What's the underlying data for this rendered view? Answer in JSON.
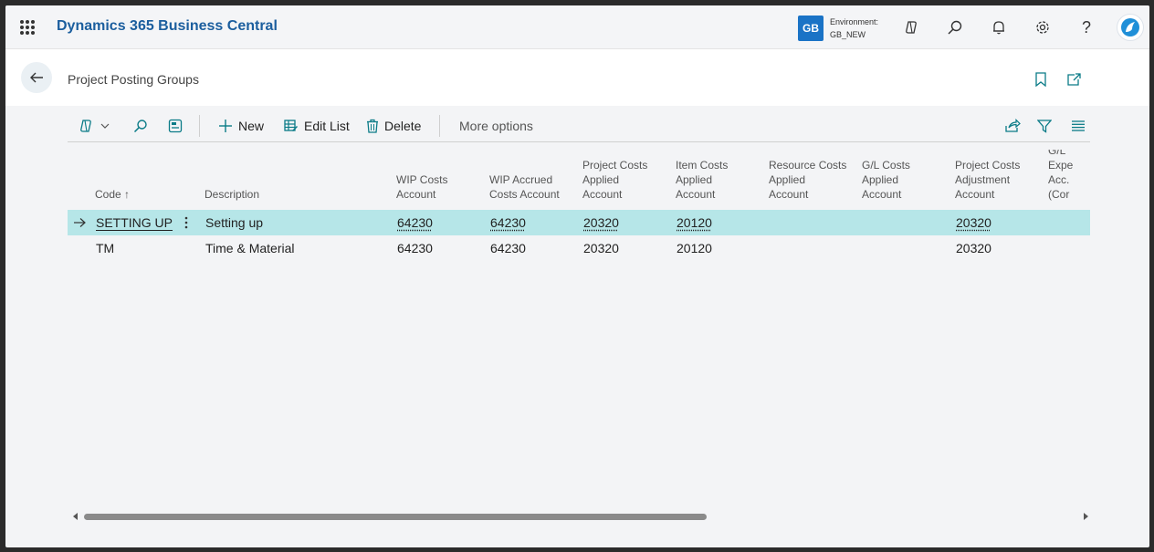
{
  "app": {
    "title": "Dynamics 365 Business Central"
  },
  "environment": {
    "badge": "GB",
    "label": "Environment:",
    "name": "GB_NEW"
  },
  "page": {
    "title": "Project Posting Groups"
  },
  "actions": {
    "new_label": "New",
    "edit_list_label": "Edit List",
    "delete_label": "Delete",
    "more_options_label": "More options"
  },
  "columns": {
    "code": [
      "Code ↑"
    ],
    "description": [
      "Description"
    ],
    "wip_costs": [
      "WIP Costs",
      "Account"
    ],
    "wip_accrued": [
      "WIP Accrued",
      "Costs Account"
    ],
    "project_costs_applied": [
      "Project Costs",
      "Applied",
      "Account"
    ],
    "item_costs_applied": [
      "Item Costs",
      "Applied",
      "Account"
    ],
    "resource_costs_applied": [
      "Resource Costs",
      "Applied",
      "Account"
    ],
    "gl_costs_applied": [
      "G/L Costs",
      "Applied",
      "Account"
    ],
    "project_costs_adjustment": [
      "Project Costs",
      "Adjustment",
      "Account"
    ],
    "gl_expense": [
      "G/L Expe",
      "Acc. (Cor"
    ]
  },
  "rows": [
    {
      "code": "SETTING UP",
      "description": "Setting up",
      "wip_costs": "64230",
      "wip_accrued": "64230",
      "project_costs_applied": "20320",
      "item_costs_applied": "20120",
      "project_costs_adjustment": "20320"
    },
    {
      "code": "TM",
      "description": "Time & Material",
      "wip_costs": "64230",
      "wip_accrued": "64230",
      "project_costs_applied": "20320",
      "item_costs_applied": "20120",
      "project_costs_adjustment": "20320"
    }
  ],
  "colors": {
    "brand": "#1b5e9e",
    "selected_row": "#b6e6e8",
    "badge": "#1a73c6"
  }
}
